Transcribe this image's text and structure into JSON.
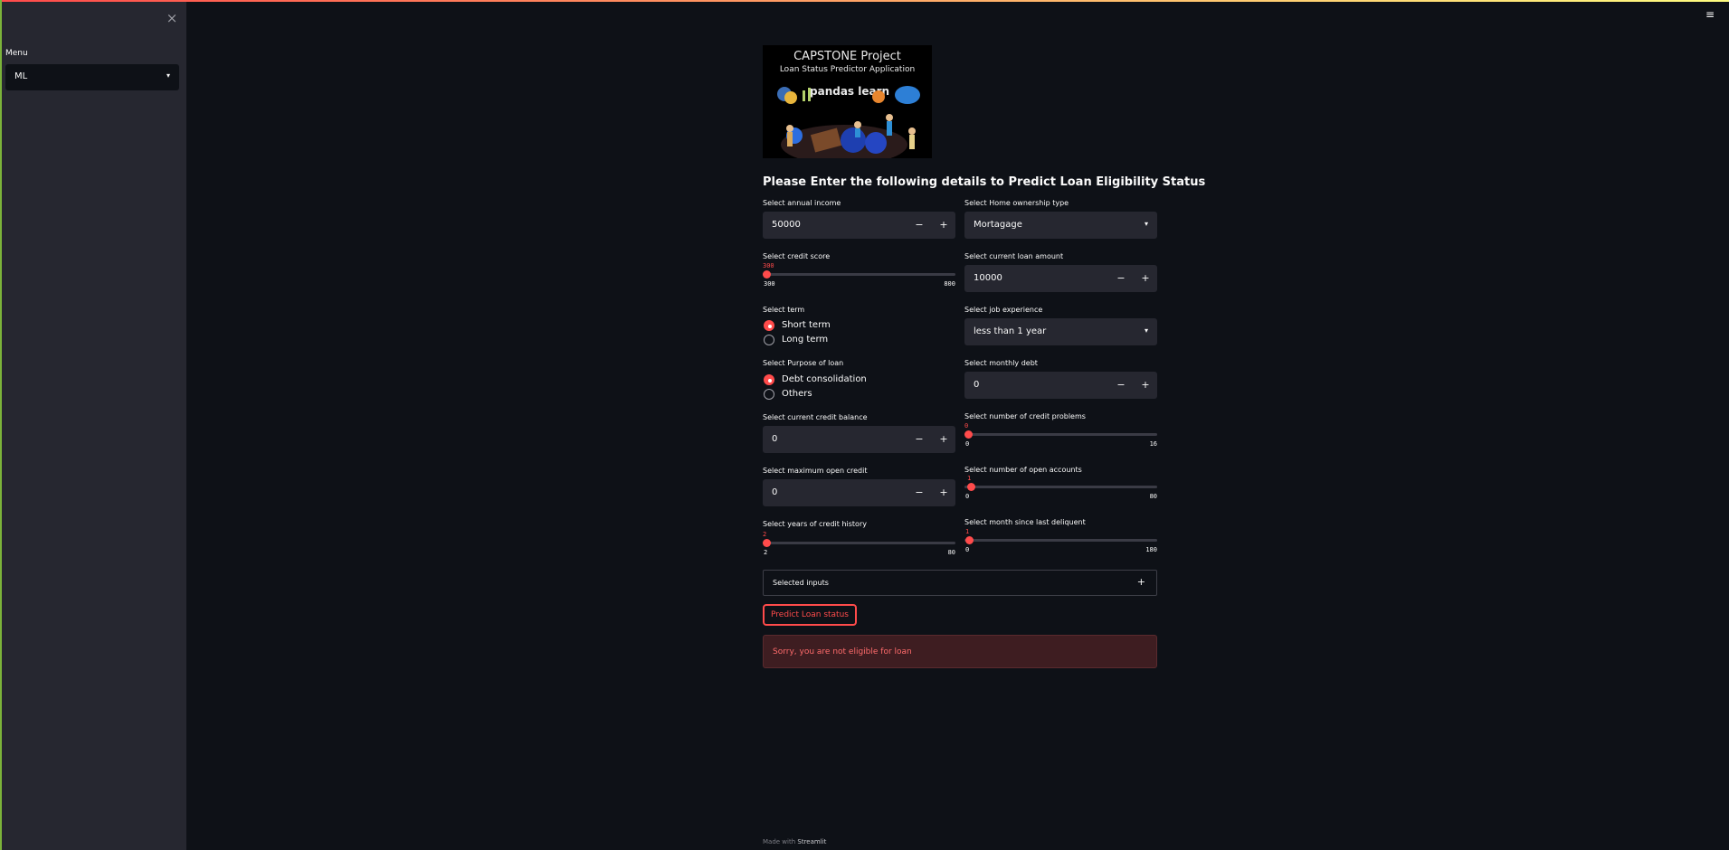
{
  "sidebar": {
    "close_icon": "×",
    "menu_label": "Menu",
    "menu_value": "ML",
    "caret": "▾"
  },
  "hamburger_icon": "≡",
  "banner": {
    "title": "CAPSTONE Project",
    "subtitle": "Loan Status Predictor Application",
    "logos": "pandas  learn"
  },
  "heading": "Please Enter the following details to Predict Loan Eligibility Status",
  "form": {
    "annual_income": {
      "label": "Select annual income",
      "value": "50000"
    },
    "home_ownership": {
      "label": "Select Home ownership type",
      "value": "Mortagage"
    },
    "credit_score": {
      "label": "Select credit score",
      "current": "300",
      "min": "300",
      "max": "800",
      "fraction": 0.0
    },
    "current_loan": {
      "label": "Select current loan amount",
      "value": "10000"
    },
    "term": {
      "label": "Select term",
      "options": [
        "Short term",
        "Long term"
      ],
      "selected": "Short term"
    },
    "job_experience": {
      "label": "Select job experience",
      "value": "less than 1 year"
    },
    "purpose": {
      "label": "Select Purpose of loan",
      "options": [
        "Debt consolidation",
        "Others"
      ],
      "selected": "Debt consolidation"
    },
    "monthly_debt": {
      "label": "Select monthly debt",
      "value": "0"
    },
    "credit_balance": {
      "label": "Select current credit balance",
      "value": "0"
    },
    "credit_problems": {
      "label": "Select number of credit problems",
      "current": "0",
      "min": "0",
      "max": "16",
      "fraction": 0.0
    },
    "max_open_credit": {
      "label": "Select maximum open credit",
      "value": "0"
    },
    "open_accounts": {
      "label": "Select number of open accounts",
      "current": "1",
      "min": "0",
      "max": "80",
      "fraction": 0.0125
    },
    "credit_history": {
      "label": "Select years of credit history",
      "current": "2",
      "min": "2",
      "max": "80",
      "fraction": 0.0
    },
    "month_delinquent": {
      "label": "Select month since last deliquent",
      "current": "1",
      "min": "0",
      "max": "180",
      "fraction": 0.0056
    }
  },
  "stepper": {
    "minus": "−",
    "plus": "+"
  },
  "expander": {
    "label": "Selected inputs",
    "icon": "+"
  },
  "predict_button": "Predict Loan status",
  "alert": "Sorry, you are not eligible for loan",
  "footer": {
    "prefix": "Made with ",
    "brand": "Streamlit"
  },
  "colors": {
    "accent": "#ff4b4b",
    "background": "#0e1117",
    "sidebar": "#262730"
  }
}
